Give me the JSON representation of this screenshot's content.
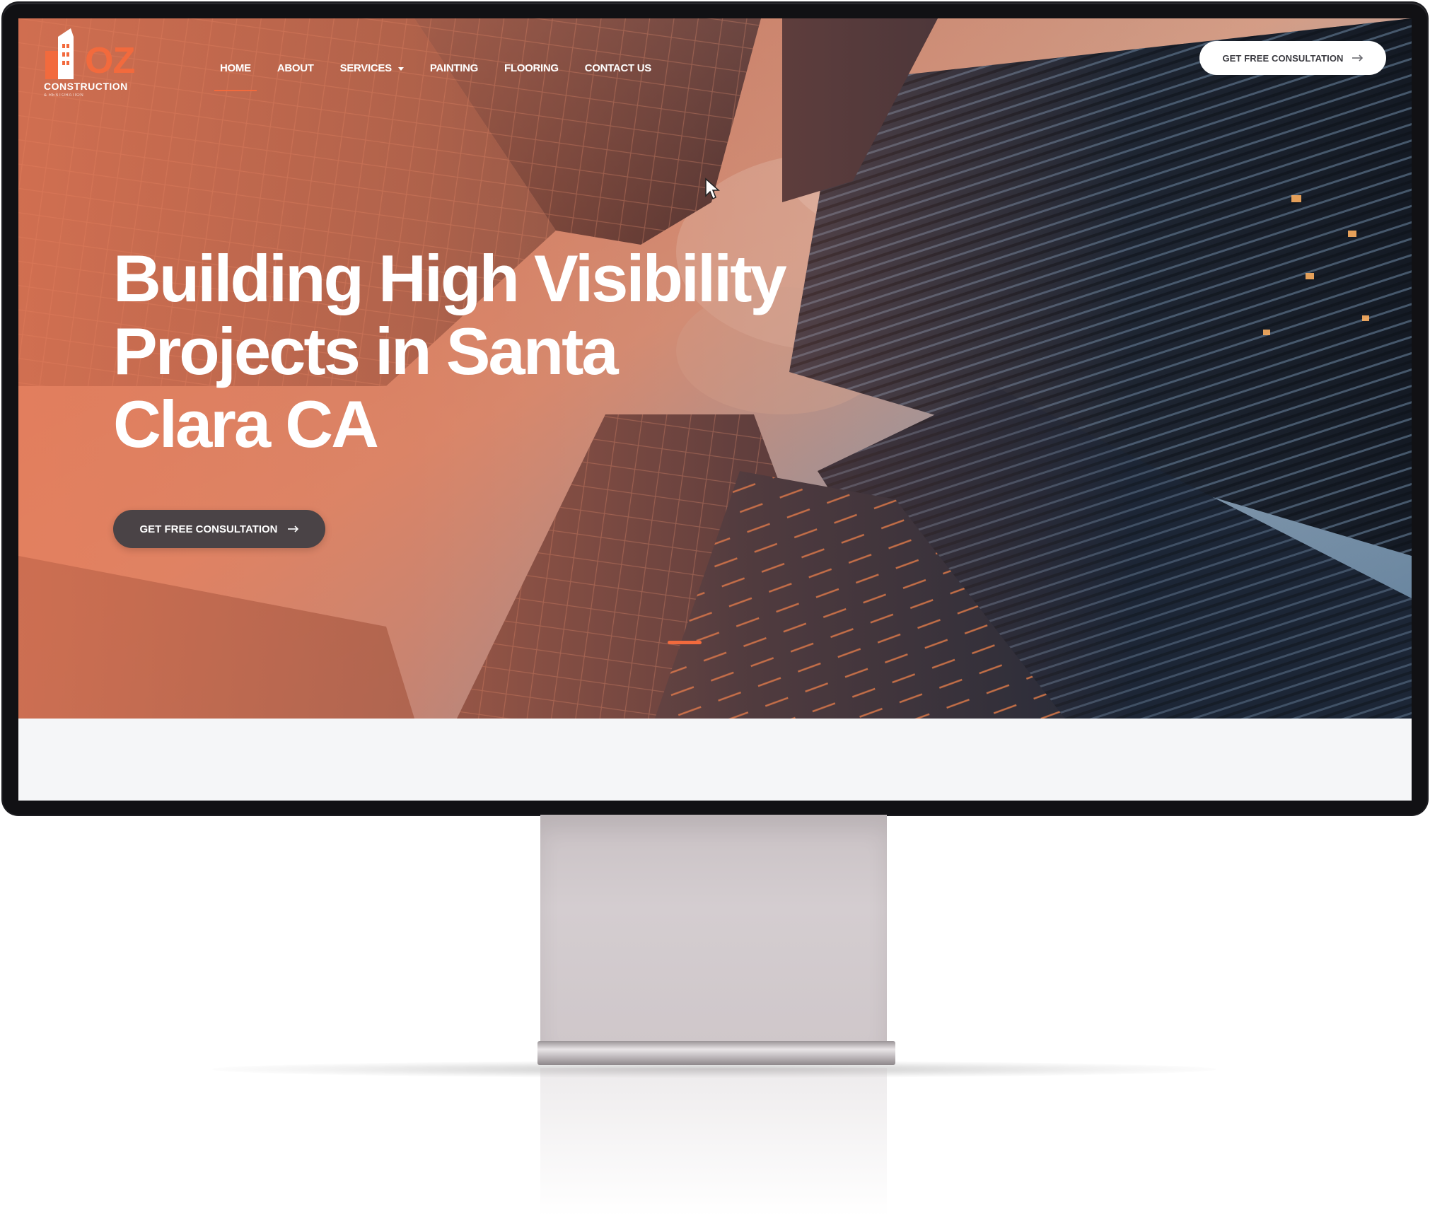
{
  "brand": {
    "logo_text": "OZ",
    "logo_sub": "CONSTRUCTION",
    "logo_tagline": "& RESTORATION",
    "accent_color": "#f26a3d"
  },
  "nav": {
    "items": [
      {
        "label": "HOME",
        "active": true
      },
      {
        "label": "ABOUT"
      },
      {
        "label": "SERVICES",
        "has_dropdown": true
      },
      {
        "label": "PAINTING"
      },
      {
        "label": "FLOORING"
      },
      {
        "label": "CONTACT US"
      }
    ],
    "cta_label": "GET FREE CONSULTATION",
    "cta_icon": "arrow-right-icon"
  },
  "hero": {
    "headline": [
      "Building High Visibility",
      "Projects in Santa",
      "Clara CA"
    ],
    "cta_label": "GET FREE CONSULTATION",
    "cta_icon": "arrow-right-icon",
    "slider": {
      "active_slide": 1
    }
  }
}
